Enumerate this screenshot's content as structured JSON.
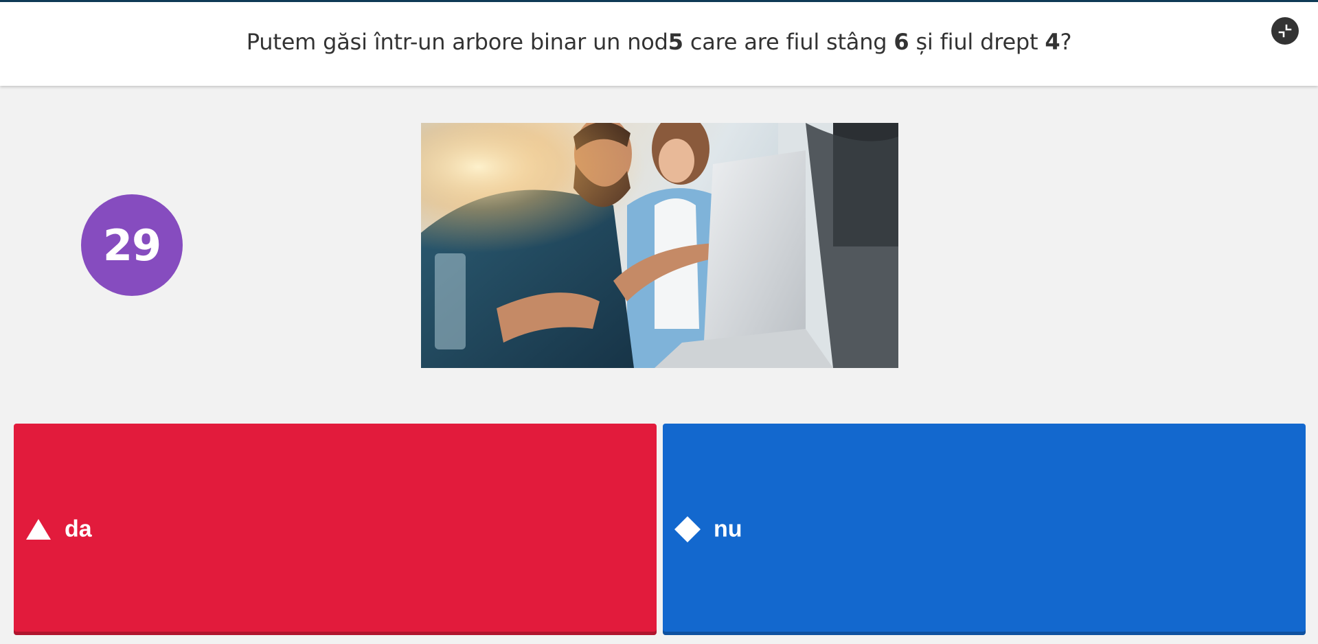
{
  "question": {
    "parts": [
      {
        "text": "Putem găsi într-un arbore binar un nod ",
        "bold": false
      },
      {
        "text": "5",
        "bold": true
      },
      {
        "text": " care are fiul stâng ",
        "bold": false
      },
      {
        "text": "6",
        "bold": true
      },
      {
        "text": " și fiul drept ",
        "bold": false
      },
      {
        "text": "4",
        "bold": true
      },
      {
        "text": "?",
        "bold": false
      }
    ]
  },
  "header": {
    "fullscreen_icon": "exit-fullscreen-icon"
  },
  "counter": {
    "value": "29",
    "color": "#864cbf"
  },
  "media": {
    "icon": "question-photo"
  },
  "answers": [
    {
      "label": "da",
      "shape": "triangle",
      "color": "#e21b3c"
    },
    {
      "label": "nu",
      "shape": "diamond",
      "color": "#1368ce"
    }
  ]
}
